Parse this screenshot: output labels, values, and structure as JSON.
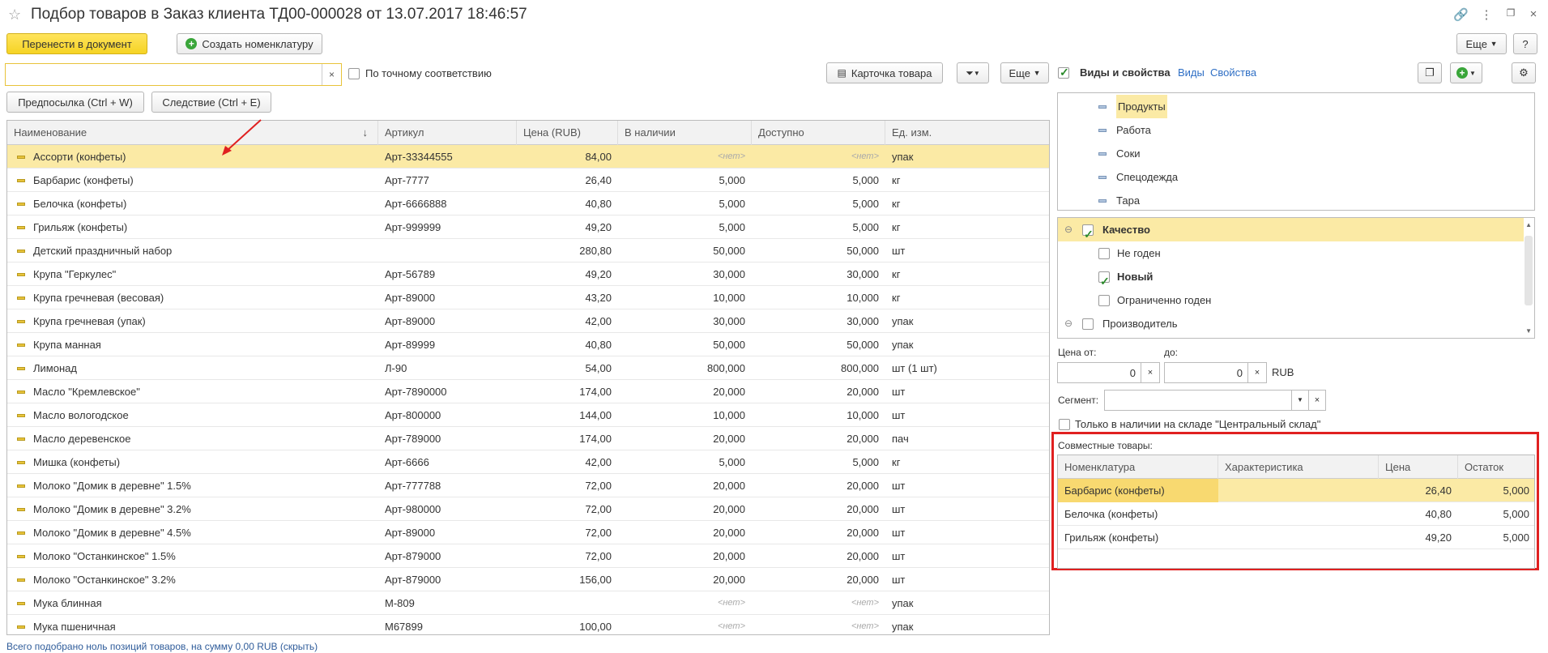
{
  "window": {
    "title": "Подбор товаров в Заказ клиента ТД00-000028 от 13.07.2017 18:46:57"
  },
  "toolbar": {
    "transfer_label": "Перенести в документ",
    "create_label": "Создать номенклатуру",
    "more_label": "Еще",
    "help_label": "?"
  },
  "search": {
    "value": "",
    "clear": "×",
    "exact_label": "По точному соответствию"
  },
  "actions": {
    "card_label": "Карточка товара",
    "more_label": "Еще",
    "prev_label": "Предпосылка (Ctrl + W)",
    "next_label": "Следствие (Ctrl + E)"
  },
  "grid": {
    "columns": [
      "Наименование",
      "Артикул",
      "Цена (RUB)",
      "В наличии",
      "Доступно",
      "Ед. изм."
    ],
    "sort_indicator": "↓",
    "rows": [
      {
        "name": "Ассорти (конфеты)",
        "art": "Арт-33344555",
        "price": "84,00",
        "stock": "<нет>",
        "avail": "<нет>",
        "unit": "упак"
      },
      {
        "name": "Барбарис (конфеты)",
        "art": "Арт-7777",
        "price": "26,40",
        "stock": "5,000",
        "avail": "5,000",
        "unit": "кг"
      },
      {
        "name": "Белочка (конфеты)",
        "art": "Арт-6666888",
        "price": "40,80",
        "stock": "5,000",
        "avail": "5,000",
        "unit": "кг"
      },
      {
        "name": "Грильяж (конфеты)",
        "art": "Арт-999999",
        "price": "49,20",
        "stock": "5,000",
        "avail": "5,000",
        "unit": "кг"
      },
      {
        "name": "Детский праздничный набор",
        "art": "",
        "price": "280,80",
        "stock": "50,000",
        "avail": "50,000",
        "unit": "шт"
      },
      {
        "name": "Крупа \"Геркулес\"",
        "art": "Арт-56789",
        "price": "49,20",
        "stock": "30,000",
        "avail": "30,000",
        "unit": "кг"
      },
      {
        "name": "Крупа гречневая (весовая)",
        "art": "Арт-89000",
        "price": "43,20",
        "stock": "10,000",
        "avail": "10,000",
        "unit": "кг"
      },
      {
        "name": "Крупа гречневая (упак)",
        "art": "Арт-89000",
        "price": "42,00",
        "stock": "30,000",
        "avail": "30,000",
        "unit": "упак"
      },
      {
        "name": "Крупа манная",
        "art": "Арт-89999",
        "price": "40,80",
        "stock": "50,000",
        "avail": "50,000",
        "unit": "упак"
      },
      {
        "name": "Лимонад",
        "art": "Л-90",
        "price": "54,00",
        "stock": "800,000",
        "avail": "800,000",
        "unit": "шт (1 шт)"
      },
      {
        "name": "Масло \"Кремлевское\"",
        "art": "Арт-7890000",
        "price": "174,00",
        "stock": "20,000",
        "avail": "20,000",
        "unit": "шт"
      },
      {
        "name": "Масло вологодское",
        "art": "Арт-800000",
        "price": "144,00",
        "stock": "10,000",
        "avail": "10,000",
        "unit": "шт"
      },
      {
        "name": "Масло деревенское",
        "art": "Арт-789000",
        "price": "174,00",
        "stock": "20,000",
        "avail": "20,000",
        "unit": "пач"
      },
      {
        "name": "Мишка (конфеты)",
        "art": "Арт-6666",
        "price": "42,00",
        "stock": "5,000",
        "avail": "5,000",
        "unit": "кг"
      },
      {
        "name": "Молоко \"Домик в деревне\" 1.5%",
        "art": "Арт-777788",
        "price": "72,00",
        "stock": "20,000",
        "avail": "20,000",
        "unit": "шт"
      },
      {
        "name": "Молоко \"Домик в деревне\" 3.2%",
        "art": "Арт-980000",
        "price": "72,00",
        "stock": "20,000",
        "avail": "20,000",
        "unit": "шт"
      },
      {
        "name": "Молоко \"Домик в деревне\" 4.5%",
        "art": "Арт-89000",
        "price": "72,00",
        "stock": "20,000",
        "avail": "20,000",
        "unit": "шт"
      },
      {
        "name": "Молоко \"Останкинское\" 1.5%",
        "art": "Арт-879000",
        "price": "72,00",
        "stock": "20,000",
        "avail": "20,000",
        "unit": "шт"
      },
      {
        "name": "Молоко \"Останкинское\" 3.2%",
        "art": "Арт-879000",
        "price": "156,00",
        "stock": "20,000",
        "avail": "20,000",
        "unit": "шт"
      },
      {
        "name": "Мука блинная",
        "art": "М-809",
        "price": "",
        "stock": "<нет>",
        "avail": "<нет>",
        "unit": "упак"
      },
      {
        "name": "Мука пшеничная",
        "art": "М67899",
        "price": "100,00",
        "stock": "<нет>",
        "avail": "<нет>",
        "unit": "упак"
      }
    ]
  },
  "right": {
    "kinds_label": "Виды и свойства",
    "kinds_link": "Виды",
    "props_link": "Свойства",
    "kinds": [
      "Продукты",
      "Работа",
      "Соки",
      "Спецодежда",
      "Тара"
    ],
    "props": [
      {
        "label": "Качество",
        "level": 0,
        "checked": true,
        "expand": "⊖"
      },
      {
        "label": "Не годен",
        "level": 1,
        "checked": false
      },
      {
        "label": "Новый",
        "level": 1,
        "checked": true
      },
      {
        "label": "Ограниченно годен",
        "level": 1,
        "checked": false
      },
      {
        "label": "Производитель",
        "level": 0,
        "checked": false,
        "expand": "⊖"
      }
    ],
    "price_from_label": "Цена от:",
    "price_to_label": "до:",
    "price_from": "0",
    "price_to": "0",
    "currency": "RUB",
    "segment_label": "Сегмент:",
    "only_stock_label": "Только в наличии на складе \"Центральный склад\"",
    "joint_label": "Совместные товары:",
    "joint_columns": [
      "Номенклатура",
      "Характеристика",
      "Цена",
      "Остаток"
    ],
    "joint_rows": [
      {
        "name": "Барбарис (конфеты)",
        "char": "",
        "price": "26,40",
        "rest": "5,000"
      },
      {
        "name": "Белочка (конфеты)",
        "char": "",
        "price": "40,80",
        "rest": "5,000"
      },
      {
        "name": "Грильяж (конфеты)",
        "char": "",
        "price": "49,20",
        "rest": "5,000"
      }
    ]
  },
  "status": {
    "text": "Всего подобрано ноль позиций товаров, на сумму 0,00 RUB (скрыть)"
  }
}
